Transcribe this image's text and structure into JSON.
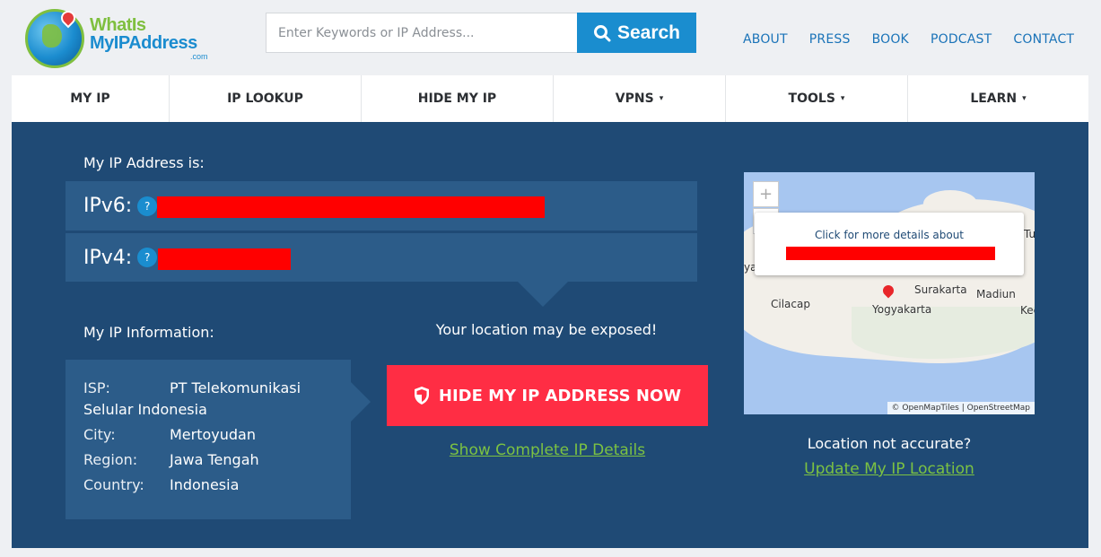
{
  "logo": {
    "line1": "WhatIs",
    "line2": "MyIPAddress",
    "suffix": ".com"
  },
  "search": {
    "placeholder": "Enter Keywords or IP Address...",
    "button_label": "Search"
  },
  "top_links": [
    "ABOUT",
    "PRESS",
    "BOOK",
    "PODCAST",
    "CONTACT"
  ],
  "nav": [
    {
      "label": "MY IP",
      "dropdown": false
    },
    {
      "label": "IP LOOKUP",
      "dropdown": false
    },
    {
      "label": "HIDE MY IP",
      "dropdown": false
    },
    {
      "label": "VPNS",
      "dropdown": true
    },
    {
      "label": "TOOLS",
      "dropdown": true
    },
    {
      "label": "LEARN",
      "dropdown": true
    }
  ],
  "caret": "▾",
  "ip": {
    "heading": "My IP Address is:",
    "ipv6_label": "IPv6:",
    "ipv4_label": "IPv4:",
    "help": "?"
  },
  "info": {
    "heading": "My IP Information:",
    "isp_key": "ISP:",
    "isp_value_1": "PT Telekomunikasi",
    "isp_value_2": "Selular Indonesia",
    "rows": [
      {
        "key": "City:",
        "value": "Mertoyudan"
      },
      {
        "key": "Region:",
        "value": "Jawa Tengah"
      },
      {
        "key": "Country:",
        "value": "Indonesia"
      }
    ]
  },
  "cta": {
    "exposed": "Your location may be exposed!",
    "hide_button": "HIDE MY IP ADDRESS NOW",
    "details_link": "Show Complete IP Details"
  },
  "map": {
    "popup_text": "Click for more details about",
    "zoom_in": "+",
    "zoom_out": "−",
    "attribution": "© OpenMapTiles | OpenStreetMap",
    "cities": [
      "Cilacap",
      "Surakarta",
      "Madiun",
      "Yogyakarta",
      "Tu",
      "Kec",
      "ya"
    ]
  },
  "location": {
    "not_accurate": "Location not accurate?",
    "update_link": "Update My IP Location"
  },
  "colors": {
    "panel": "#1f4a75",
    "row": "#2c5c89",
    "accent_blue": "#1a8dcf",
    "cta_red": "#ff2d44",
    "link_green": "#7cc242"
  }
}
